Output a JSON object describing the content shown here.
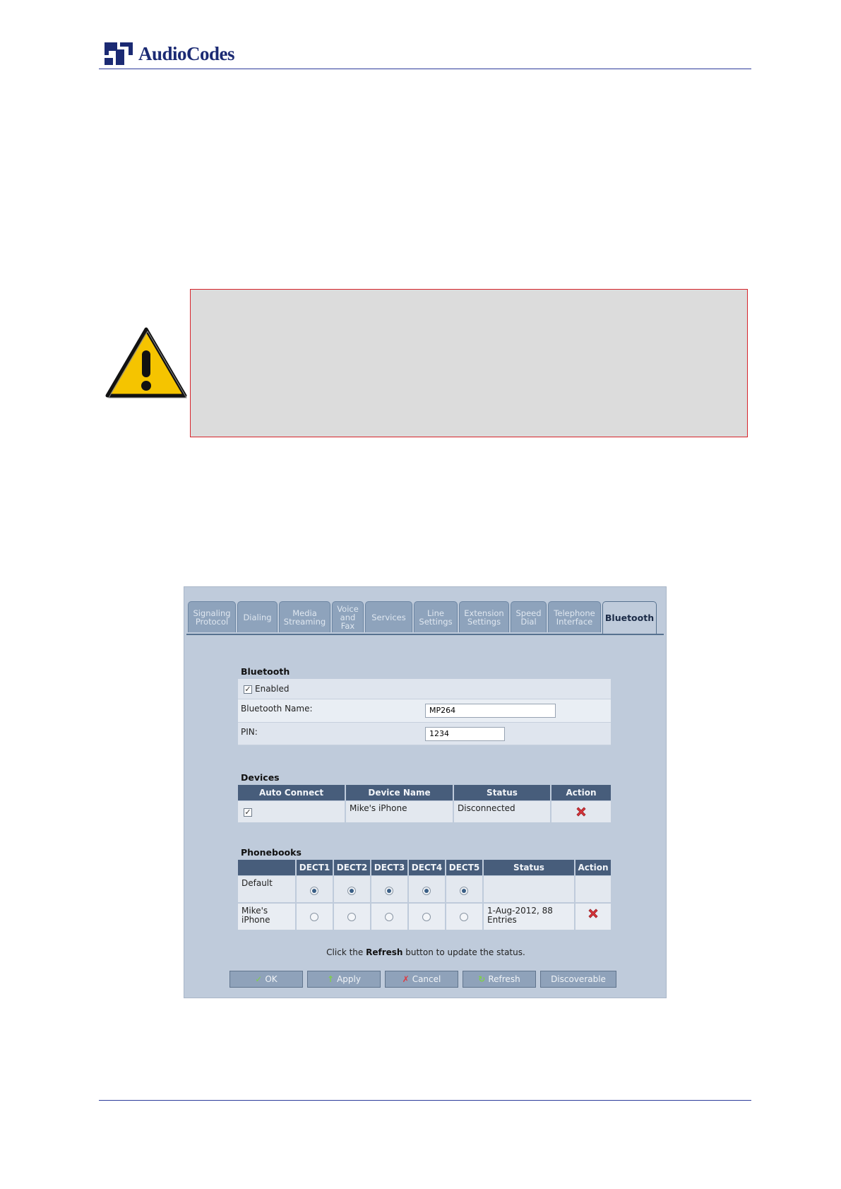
{
  "header": {
    "brand": "AudioCodes"
  },
  "screenshot": {
    "tabs": [
      {
        "label": "Signaling Protocol"
      },
      {
        "label": "Dialing"
      },
      {
        "label": "Media Streaming"
      },
      {
        "label": "Voice and Fax"
      },
      {
        "label": "Services"
      },
      {
        "label": "Line Settings"
      },
      {
        "label": "Extension Settings"
      },
      {
        "label": "Speed Dial"
      },
      {
        "label": "Telephone Interface"
      },
      {
        "label": "Bluetooth"
      }
    ],
    "bluetooth": {
      "title": "Bluetooth",
      "enabled_label": "Enabled",
      "enabled_checked": true,
      "name_label": "Bluetooth Name:",
      "name_value": "MP264",
      "pin_label": "PIN:",
      "pin_value": "1234"
    },
    "devices": {
      "title": "Devices",
      "headers": [
        "Auto Connect",
        "Device Name",
        "Status",
        "Action"
      ],
      "rows": [
        {
          "auto_connect": true,
          "device_name": "Mike's iPhone",
          "status": "Disconnected"
        }
      ]
    },
    "phonebooks": {
      "title": "Phonebooks",
      "headers": [
        "",
        "DECT1",
        "DECT2",
        "DECT3",
        "DECT4",
        "DECT5",
        "Status",
        "Action"
      ],
      "rows": [
        {
          "name": "Default",
          "selected": [
            true,
            true,
            true,
            true,
            true
          ],
          "status": ""
        },
        {
          "name": "Mike's iPhone",
          "selected": [
            false,
            false,
            false,
            false,
            false
          ],
          "status": "1-Aug-2012, 88 Entries"
        }
      ]
    },
    "hint": {
      "prefix": "Click the ",
      "bold": "Refresh",
      "suffix": " button to update the status."
    },
    "buttons": [
      {
        "label": "OK",
        "icon": "check-icon"
      },
      {
        "label": "Apply",
        "icon": "apply-arrow-icon"
      },
      {
        "label": "Cancel",
        "icon": "x-icon"
      },
      {
        "label": "Refresh",
        "icon": "refresh-icon"
      },
      {
        "label": "Discoverable",
        "icon": ""
      }
    ]
  },
  "colors": {
    "note_border": "#d6232a",
    "note_bg": "#dcdcdc",
    "brand_blue": "#1b2a73",
    "warning_yellow": "#f5c400"
  }
}
